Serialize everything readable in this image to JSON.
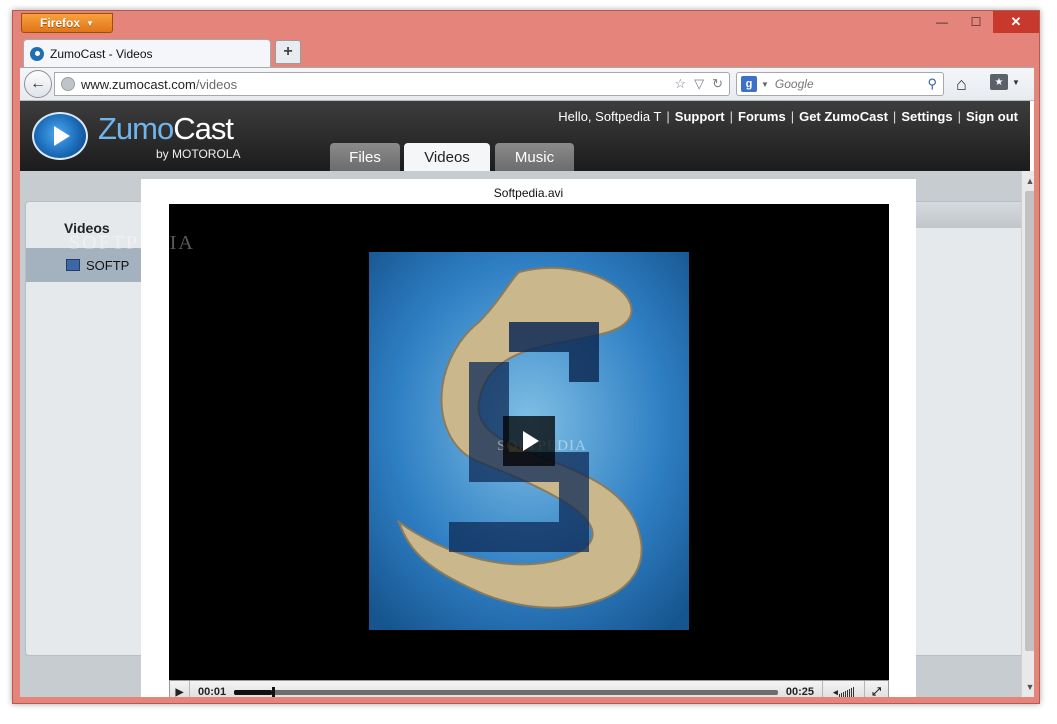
{
  "browser": {
    "menu_button_label": "Firefox",
    "tab_title": "ZumoCast - Videos",
    "new_tab_label": "+",
    "url_host": "www.zumocast.com",
    "url_path": "/videos",
    "search_placeholder": "Google"
  },
  "site": {
    "logo_primary": "Zumo",
    "logo_secondary": "Cast",
    "logo_byline": "by MOTOROLA",
    "greeting": "Hello, Softpedia T",
    "links": [
      "Support",
      "Forums",
      "Get ZumoCast",
      "Settings",
      "Sign out"
    ],
    "tabs": [
      {
        "label": "Files",
        "active": false
      },
      {
        "label": "Videos",
        "active": true
      },
      {
        "label": "Music",
        "active": false
      }
    ]
  },
  "sidebar": {
    "title": "Videos",
    "item_label": "SOFTP"
  },
  "watermark": {
    "top": "SOFTPEDIA",
    "mid": "SOFTPEDIA"
  },
  "player": {
    "file_name": "Softpedia.avi",
    "current_time": "00:01",
    "duration": "00:25",
    "progress_fraction": 0.07
  },
  "colors": {
    "window_frame": "#e4847b",
    "header_bg": "#2a2a2a",
    "logo_blue": "#6fb4ec",
    "page_bg": "#c7ccd1"
  }
}
